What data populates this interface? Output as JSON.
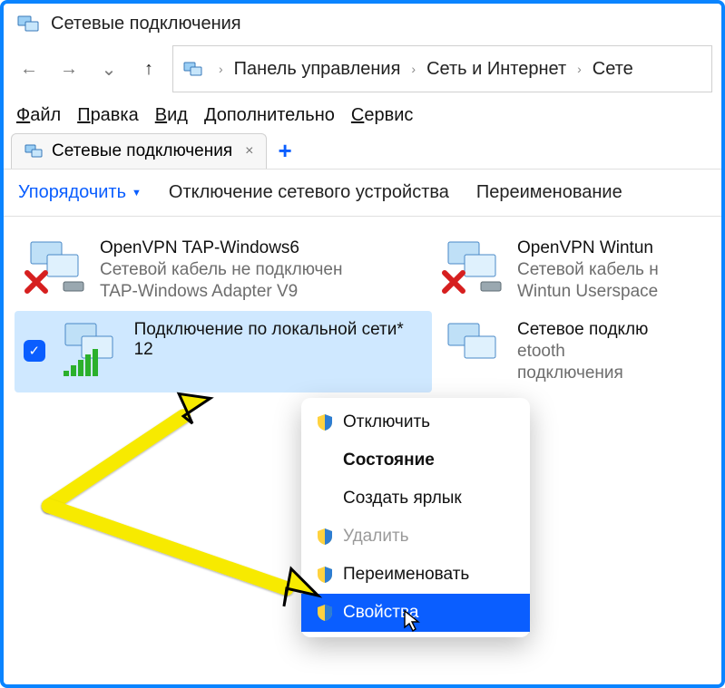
{
  "window": {
    "title": "Сетевые подключения"
  },
  "nav": {
    "back": "←",
    "forward": "→",
    "dropdown": "⌄",
    "up": "↑"
  },
  "breadcrumb": {
    "items": [
      "Панель управления",
      "Сеть и Интернет",
      "Сете"
    ]
  },
  "menubar": {
    "file": "Файл",
    "edit": "Правка",
    "view": "Вид",
    "extra": "Дополнительно",
    "service": "Сервис"
  },
  "tabs": {
    "active": "Сетевые подключения",
    "close": "×",
    "new": "+"
  },
  "toolbar": {
    "organize": "Упорядочить",
    "disable": "Отключение сетевого устройства",
    "rename": "Переименование"
  },
  "connections": [
    {
      "name": "OpenVPN TAP-Windows6",
      "status": "Сетевой кабель не подключен",
      "adapter": "TAP-Windows Adapter V9",
      "unplugged": true
    },
    {
      "name": "OpenVPN Wintun",
      "status": "Сетевой кабель н",
      "adapter": "Wintun Userspace",
      "unplugged": true
    },
    {
      "name": "Подключение по локальной сети* 12",
      "status": "",
      "adapter": "",
      "selected": true,
      "signal": true
    },
    {
      "name": "Сетевое подклю",
      "status": "etooth",
      "adapter": "подключения",
      "truncated": true
    }
  ],
  "context_menu": {
    "items": [
      {
        "label": "Отключить",
        "shield": true
      },
      {
        "label": "Состояние",
        "bold": true
      },
      {
        "label": "Создать ярлык"
      },
      {
        "label": "Удалить",
        "shield": true,
        "disabled": true
      },
      {
        "label": "Переименовать",
        "shield": true
      },
      {
        "label": "Свойства",
        "shield": true,
        "selected": true
      }
    ]
  }
}
